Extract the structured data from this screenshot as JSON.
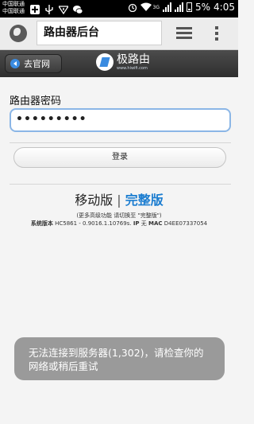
{
  "status_bar": {
    "carrier_1": "中国联通",
    "carrier_2": "中国联通",
    "network": "3G",
    "battery": "5%",
    "time": "4:05"
  },
  "browser": {
    "url_title": "路由器后台"
  },
  "header": {
    "back_label": "去官网",
    "logo_text": "极路由",
    "logo_subtext": "www.hiwifi.com"
  },
  "form": {
    "password_label": "路由器密码",
    "password_value": "•••••••••",
    "login_label": "登录"
  },
  "version": {
    "mobile": "移动版",
    "separator": "|",
    "full": "完整版",
    "note": "(更多高级功能 请切换至 \"完整版\")",
    "info_label_1": "系统版本",
    "info_value_1": "HC5861 - 0.9016.1.10769s.",
    "info_label_2": "IP",
    "info_value_2": "无",
    "info_label_3": "MAC",
    "info_value_3": "D4EE07337054"
  },
  "toast": {
    "line1": "无法连接到服务器(1,302)，请检查你的",
    "line2": "网络或稍后重试"
  }
}
